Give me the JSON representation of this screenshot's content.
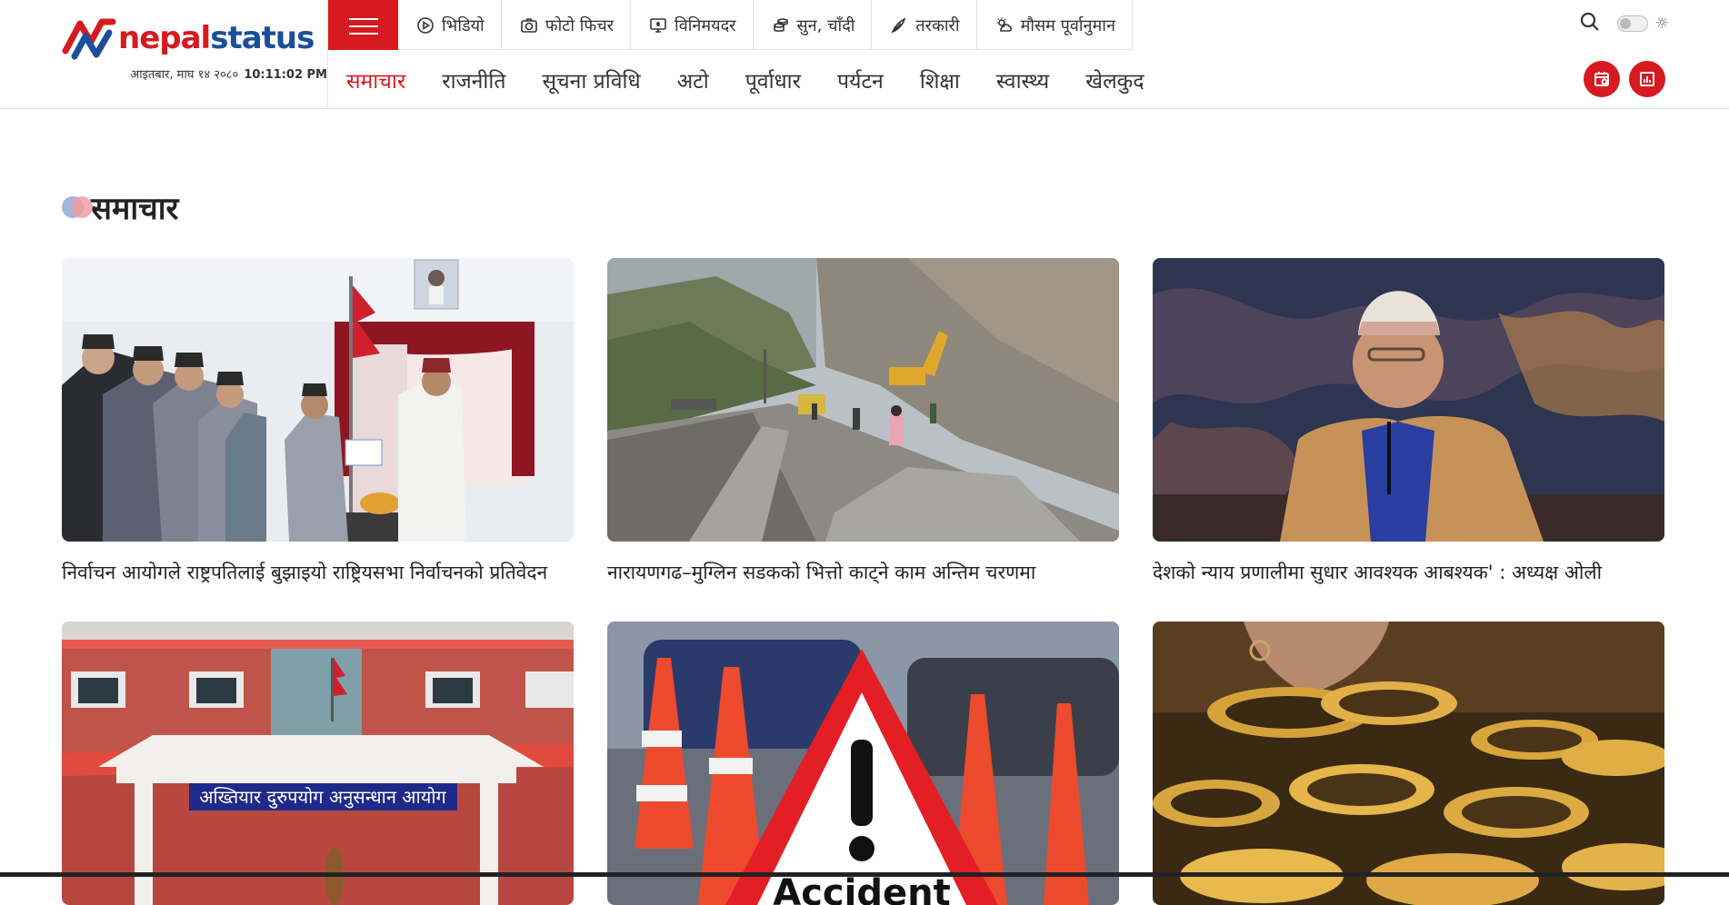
{
  "brand": {
    "logo_part1": "nepal",
    "logo_part2": "status"
  },
  "header": {
    "date": "आइतबार, माघ १४ २०८०",
    "time": "10:11:02 PM"
  },
  "top_links": [
    {
      "label": "भिडियो",
      "icon": "play-icon"
    },
    {
      "label": "फोटो फिचर",
      "icon": "camera-icon"
    },
    {
      "label": "विनिमयदर",
      "icon": "exchange-icon"
    },
    {
      "label": "सुन, चाँदी",
      "icon": "coins-icon"
    },
    {
      "label": "तरकारी",
      "icon": "vegetable-icon"
    },
    {
      "label": "मौसम पूर्वानुमान",
      "icon": "weather-icon"
    }
  ],
  "nav": [
    {
      "label": "समाचार",
      "active": true
    },
    {
      "label": "राजनीति"
    },
    {
      "label": "सूचना प्रविधि"
    },
    {
      "label": "अटो"
    },
    {
      "label": "पूर्वाधार"
    },
    {
      "label": "पर्यटन"
    },
    {
      "label": "शिक्षा"
    },
    {
      "label": "स्वास्थ्य"
    },
    {
      "label": "खेलकुद"
    }
  ],
  "section": {
    "title": "समाचार"
  },
  "articles": [
    {
      "title": "निर्वाचन आयोगले राष्ट्रपतिलाई बुझाइयो राष्ट्रियसभा निर्वाचनको प्रतिवेदन",
      "image": "ceremony-photo"
    },
    {
      "title": "नारायणगढ–मुग्लिन सडकको भित्तो काट्ने काम अन्तिम चरणमा",
      "image": "road-construction-photo"
    },
    {
      "title": "देशको न्याय प्रणालीमा सुधार आवश्यक आबश्यक' : अध्यक्ष ओली",
      "image": "speaker-portrait-photo"
    },
    {
      "title": "",
      "image": "government-building-photo",
      "banner": "अख्तियार दुरुपयोग अनुसन्धान आयोग"
    },
    {
      "title": "",
      "image": "accident-sign-photo",
      "sign_text": "Accident"
    },
    {
      "title": "",
      "image": "gold-jewelry-photo"
    }
  ],
  "colors": {
    "accent": "#d71920",
    "brand_blue": "#1b4f9c"
  }
}
